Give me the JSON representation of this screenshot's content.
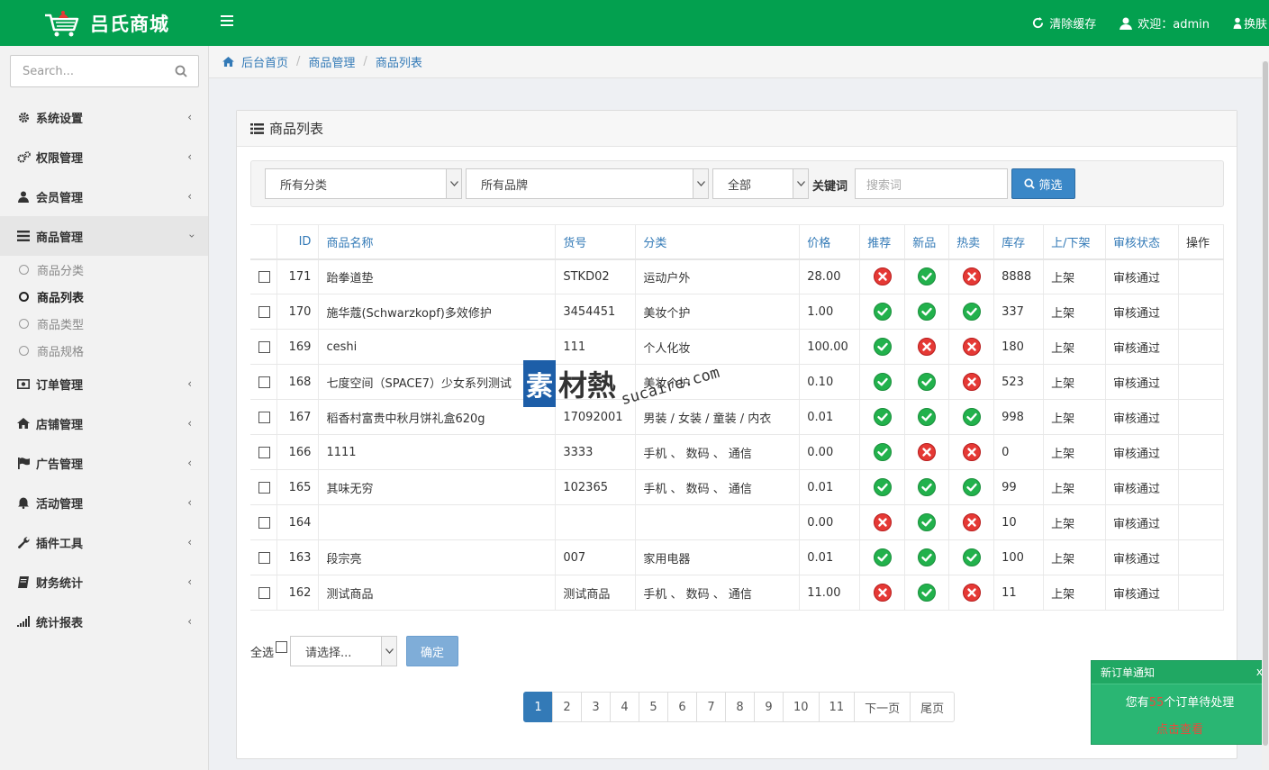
{
  "header": {
    "brand": "吕氏商城",
    "clear_cache": "清除缓存",
    "welcome": "欢迎：admin",
    "skin": "换肤"
  },
  "sidebar": {
    "search_placeholder": "Search...",
    "items": [
      {
        "label": "系统设置",
        "icon": "gear-icon"
      },
      {
        "label": "权限管理",
        "icon": "gears-icon"
      },
      {
        "label": "会员管理",
        "icon": "user-icon"
      },
      {
        "label": "商品管理",
        "icon": "list-icon"
      },
      {
        "label": "订单管理",
        "icon": "money-icon"
      },
      {
        "label": "店铺管理",
        "icon": "home-icon"
      },
      {
        "label": "广告管理",
        "icon": "flag-icon"
      },
      {
        "label": "活动管理",
        "icon": "bell-icon"
      },
      {
        "label": "插件工具",
        "icon": "wrench-icon"
      },
      {
        "label": "财务统计",
        "icon": "book-icon"
      },
      {
        "label": "统计报表",
        "icon": "signal-icon"
      }
    ],
    "submenu": [
      "商品分类",
      "商品列表",
      "商品类型",
      "商品规格"
    ]
  },
  "breadcrumb": [
    "后台首页",
    "商品管理",
    "商品列表"
  ],
  "panel": {
    "title": "商品列表",
    "filter": {
      "category": "所有分类",
      "brand": "所有品牌",
      "scope": "全部",
      "keyword_label": "关键词",
      "keyword_placeholder": "搜索词",
      "button": "筛选"
    },
    "columns": [
      "ID",
      "商品名称",
      "货号",
      "分类",
      "价格",
      "推荐",
      "新品",
      "热卖",
      "库存",
      "上/下架",
      "审核状态",
      "操作"
    ],
    "rows": [
      {
        "id": "171",
        "name": "跆拳道垫",
        "sn": "STKD02",
        "cat": "运动户外",
        "price": "28.00",
        "rec": false,
        "new": true,
        "hot": false,
        "stock": "8888",
        "shelf": "上架",
        "audit": "审核通过"
      },
      {
        "id": "170",
        "name": "施华蔻(Schwarzkopf)多效修护",
        "sn": "3454451",
        "cat": "美妆个护",
        "price": "1.00",
        "rec": true,
        "new": true,
        "hot": true,
        "stock": "337",
        "shelf": "上架",
        "audit": "审核通过"
      },
      {
        "id": "169",
        "name": "ceshi",
        "sn": "111",
        "cat": "个人化妆",
        "price": "100.00",
        "rec": true,
        "new": false,
        "hot": false,
        "stock": "180",
        "shelf": "上架",
        "audit": "审核通过"
      },
      {
        "id": "168",
        "name": "七度空间（SPACE7）少女系列测试",
        "sn": "",
        "cat": "美妆个护",
        "price": "0.10",
        "rec": true,
        "new": true,
        "hot": false,
        "stock": "523",
        "shelf": "上架",
        "audit": "审核通过"
      },
      {
        "id": "167",
        "name": "稻香村富贵中秋月饼礼盒620g",
        "sn": "17092001",
        "cat": "男装 / 女装 / 童装 / 内衣",
        "price": "0.01",
        "rec": true,
        "new": true,
        "hot": true,
        "stock": "998",
        "shelf": "上架",
        "audit": "审核通过"
      },
      {
        "id": "166",
        "name": "1111",
        "sn": "3333",
        "cat": "手机 、 数码 、 通信",
        "price": "0.00",
        "rec": true,
        "new": false,
        "hot": false,
        "stock": "0",
        "shelf": "上架",
        "audit": "审核通过"
      },
      {
        "id": "165",
        "name": "其味无穷",
        "sn": "102365",
        "cat": "手机 、 数码 、 通信",
        "price": "0.01",
        "rec": true,
        "new": true,
        "hot": true,
        "stock": "99",
        "shelf": "上架",
        "audit": "审核通过"
      },
      {
        "id": "164",
        "name": "",
        "sn": "",
        "cat": "",
        "price": "0.00",
        "rec": false,
        "new": true,
        "hot": false,
        "stock": "10",
        "shelf": "上架",
        "audit": "审核通过"
      },
      {
        "id": "163",
        "name": "段宗亮",
        "sn": "007",
        "cat": "家用电器",
        "price": "0.01",
        "rec": true,
        "new": true,
        "hot": true,
        "stock": "100",
        "shelf": "上架",
        "audit": "审核通过"
      },
      {
        "id": "162",
        "name": "测试商品",
        "sn": "测试商品",
        "cat": "手机 、 数码 、 通信",
        "price": "11.00",
        "rec": false,
        "new": true,
        "hot": false,
        "stock": "11",
        "shelf": "上架",
        "audit": "审核通过"
      }
    ],
    "bulk": {
      "select_all": "全选",
      "action_placeholder": "请选择...",
      "confirm": "确定"
    },
    "pagination": [
      "1",
      "2",
      "3",
      "4",
      "5",
      "6",
      "7",
      "8",
      "9",
      "10",
      "11",
      "下一页",
      "尾页"
    ],
    "current_page": "1"
  },
  "notification": {
    "title": "新订单通知",
    "close": "x",
    "msg_prefix": "您有",
    "count": "55",
    "msg_suffix": "个订单待处理",
    "link": "点击查看"
  },
  "watermark": {
    "mark": "素",
    "text": "材熱",
    "url": "sucaire.com"
  },
  "colors": {
    "brand_green": "#03a04f",
    "link_blue": "#337ab7",
    "ok_green": "#22b14c",
    "no_red": "#e53935"
  }
}
